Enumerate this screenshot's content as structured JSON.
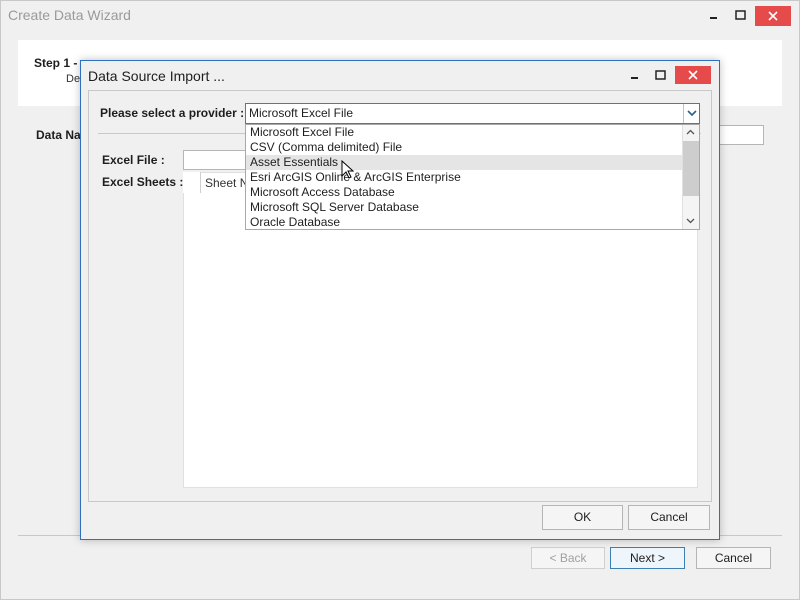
{
  "wizard": {
    "title": "Create Data Wizard",
    "step_title": "Step 1 - ",
    "step_desc": "De",
    "data_name_label": "Data Na",
    "back_label": "< Back",
    "next_label": "Next >",
    "cancel_label": "Cancel"
  },
  "dialog": {
    "title": "Data Source Import ...",
    "provider_label": "Please select a provider :",
    "provider_value": "Microsoft Excel File",
    "excel_file_label": "Excel File :",
    "excel_sheets_label": "Excel Sheets :",
    "sheet_column_header": "Sheet Na",
    "ok_label": "OK",
    "cancel_label": "Cancel"
  },
  "dropdown": {
    "items": [
      "Microsoft Excel File",
      "CSV (Comma delimited) File",
      "Asset Essentials",
      "Esri ArcGIS Online & ArcGIS Enterprise",
      "Microsoft Access Database",
      "Microsoft SQL Server Database",
      "Oracle Database"
    ],
    "highlighted": "Asset Essentials"
  },
  "colors": {
    "accent": "#3c7fb1",
    "close_red": "#e54b4b",
    "dialog_border": "#2e6fbf"
  }
}
